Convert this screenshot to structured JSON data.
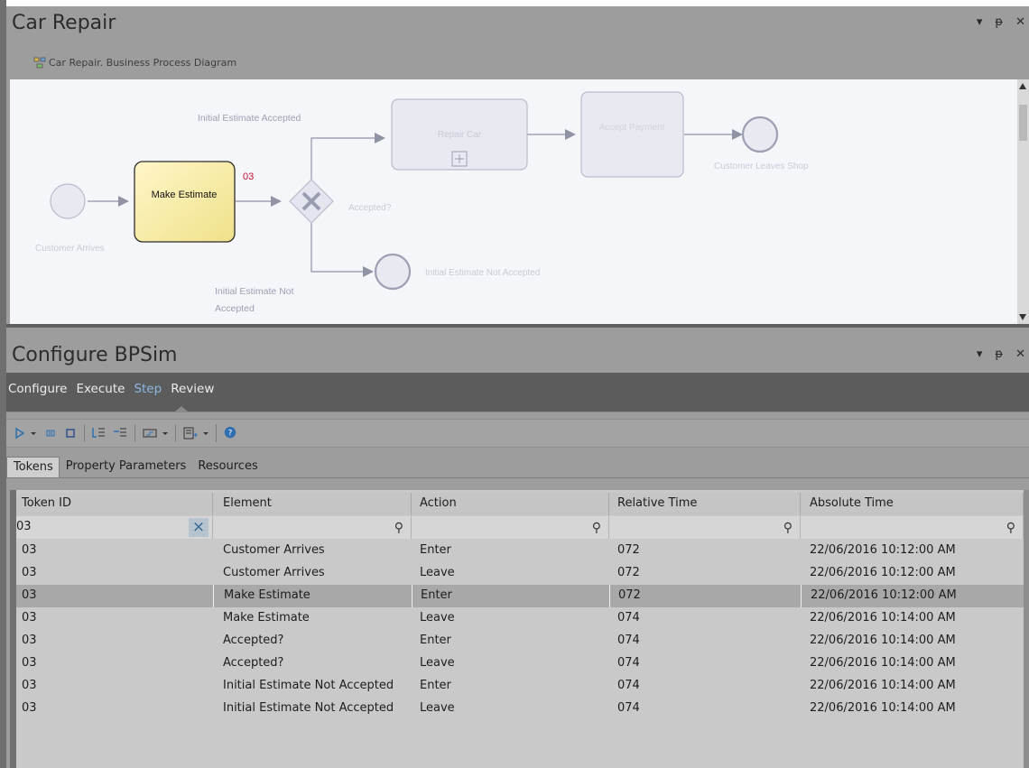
{
  "diagram_panel": {
    "title": "Car Repair",
    "diagram_tab_label": "Car Repair.  Business Process Diagram",
    "controls": [
      "▾",
      "ᵽ",
      "✕"
    ],
    "elements": {
      "start_event_label": "Customer Arrives",
      "task_make_estimate": "Make Estimate",
      "token_badge": "03",
      "gateway_label": "Accepted?",
      "flow_accepted_label": "Initial Estimate Accepted",
      "flow_not_accepted_label_line1": "Initial Estimate Not",
      "flow_not_accepted_label_line2": "Accepted",
      "task_repair_car": "Repair Car",
      "task_accept_payment": "Accept Payment",
      "end_event_leaves": "Customer Leaves Shop",
      "end_event_not_accepted": "Initial Estimate Not Accepted"
    }
  },
  "bpsim_panel": {
    "title": "Configure BPSim",
    "controls": [
      "▾",
      "ᵽ",
      "✕"
    ],
    "menu": [
      "Configure",
      "Execute",
      "Step",
      "Review"
    ],
    "active_menu": "Step",
    "tabs": [
      "Tokens",
      "Property Parameters",
      "Resources"
    ],
    "active_tab": "Tokens",
    "columns": [
      "Token ID",
      "Element",
      "Action",
      "Relative Time",
      "Absolute Time"
    ],
    "filter": {
      "token_id": "03"
    },
    "rows": [
      [
        "03",
        "Customer Arrives",
        "Enter",
        "072",
        "22/06/2016 10:12:00 AM"
      ],
      [
        "03",
        "Customer Arrives",
        "Leave",
        "072",
        "22/06/2016 10:12:00 AM"
      ],
      [
        "03",
        "Make Estimate",
        "Enter",
        "072",
        "22/06/2016 10:12:00 AM"
      ],
      [
        "03",
        "Make Estimate",
        "Leave",
        "074",
        "22/06/2016 10:14:00 AM"
      ],
      [
        "03",
        "Accepted?",
        "Enter",
        "074",
        "22/06/2016 10:14:00 AM"
      ],
      [
        "03",
        "Accepted?",
        "Leave",
        "074",
        "22/06/2016 10:14:00 AM"
      ],
      [
        "03",
        "Initial Estimate Not Accepted",
        "Enter",
        "074",
        "22/06/2016 10:14:00 AM"
      ],
      [
        "03",
        "Initial Estimate Not Accepted",
        "Leave",
        "074",
        "22/06/2016 10:14:00 AM"
      ]
    ],
    "selected_row": 2
  },
  "colors": {
    "active_menu": "#8cb7e2",
    "badge": "#c8102e",
    "task_fill": "#f7eeb0",
    "faded_shape": "#ccccdd"
  }
}
